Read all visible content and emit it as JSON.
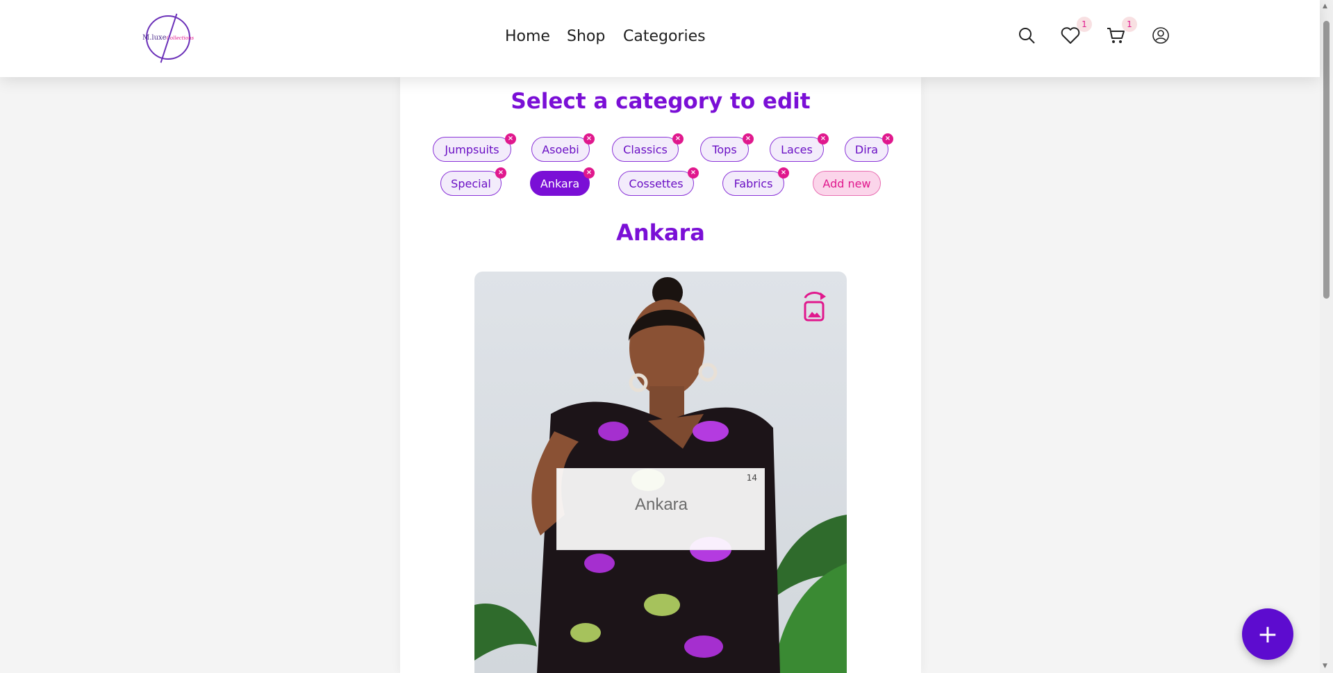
{
  "header": {
    "logo_text": "M.luxe",
    "logo_text_accent": "Collections",
    "nav": [
      "Home",
      "Shop",
      "Categories"
    ],
    "wishlist_count": "1",
    "cart_count": "1"
  },
  "editor": {
    "title": "Select a category to edit",
    "remove_glyph": "×",
    "categories": [
      "Jumpsuits",
      "Asoebi",
      "Classics",
      "Tops",
      "Laces",
      "Dira",
      "Special",
      "Ankara",
      "Cossettes",
      "Fabrics"
    ],
    "active_category": "Ankara",
    "add_label": "Add new",
    "selected_title": "Ankara",
    "name_input_value": "Ankara",
    "name_char_count": "14"
  },
  "fab": {
    "label": "+"
  },
  "colors": {
    "primary": "#7a0fd6",
    "accent": "#e0188d",
    "fab": "#5d0ccf"
  }
}
